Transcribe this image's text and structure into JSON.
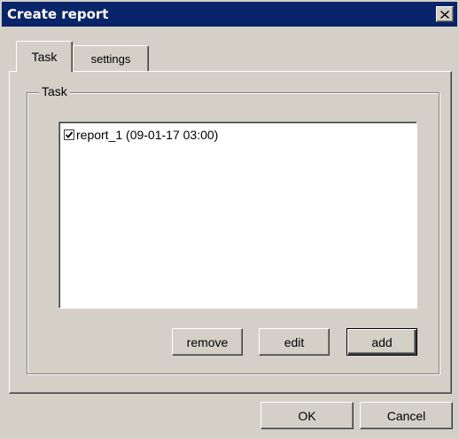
{
  "window": {
    "title": "Create report"
  },
  "tabs": [
    {
      "label": "Task",
      "active": true
    },
    {
      "label": "settings",
      "active": false
    }
  ],
  "task_group": {
    "legend": "Task",
    "items": [
      {
        "label": "report_1 (09-01-17 03:00)",
        "checked": true
      }
    ],
    "buttons": {
      "remove": "remove",
      "edit": "edit",
      "add": "add"
    }
  },
  "footer": {
    "ok": "OK",
    "cancel": "Cancel"
  },
  "icons": {
    "close": "close-icon",
    "check": "checkmark-icon"
  },
  "colors": {
    "titlebar": "#0a246a",
    "face": "#d4d0c8"
  }
}
